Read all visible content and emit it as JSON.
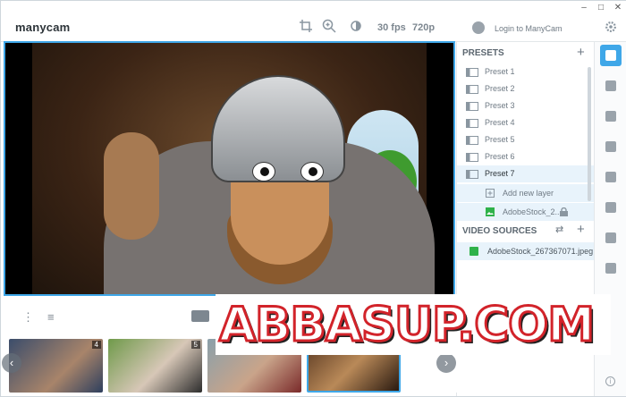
{
  "app": {
    "logo": "manycam"
  },
  "toolbar": {
    "fps": "30 fps",
    "resolution": "720p",
    "login": "Login to ManyCam",
    "icons": [
      "crop-icon",
      "zoom-icon",
      "brightness-icon",
      "user-icon",
      "gear-icon"
    ]
  },
  "presets": {
    "title": "PRESETS",
    "items": [
      "Preset 1",
      "Preset 2",
      "Preset 3",
      "Preset 4",
      "Preset 5",
      "Preset 6",
      "Preset 7"
    ],
    "active_item": "Preset 7",
    "add_layer": "Add new layer",
    "layer_name": "AdobeStock_2..."
  },
  "video_sources": {
    "title": "VIDEO SOURCES",
    "item": "AdobeStock_267367071.jpeg"
  },
  "thumbnails": [
    {
      "badge": "4"
    },
    {
      "badge": "5"
    },
    {
      "badge": ""
    },
    {
      "badge": ""
    }
  ],
  "watermark": "ABBASUP.COM",
  "colors": {
    "accent": "#3fa7e8",
    "watermark_stroke": "#d2232a"
  }
}
